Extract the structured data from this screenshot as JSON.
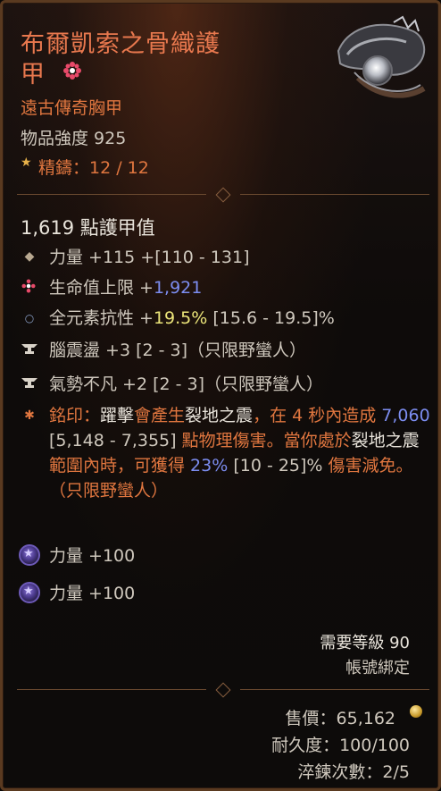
{
  "item": {
    "title_line1": "布爾凱索之骨織護",
    "title_line2": "甲",
    "icon": "armor-chest-icon",
    "type": "遠古傳奇胸甲",
    "item_power": "物品強度 925",
    "masterwork": "精鑄：12 / 12"
  },
  "stats": {
    "armor": "1,619 點護甲值",
    "affixes": [
      {
        "icon": "diamond-bullet-icon",
        "prefix": "力量 +115",
        "hl": "",
        "suffix": " +[110 - 131]"
      },
      {
        "icon": "flower-icon",
        "prefix": "生命值上限 +",
        "hl": "1,921",
        "suffix": ""
      },
      {
        "icon": "circle-bullet-icon",
        "prefix": "全元素抗性 +",
        "hl": "19.5%",
        "suffix": " [15.6 - 19.5]%"
      },
      {
        "icon": "anvil-icon",
        "prefix": "腦震盪 +3 [2 - 3]（只限野蠻人）",
        "hl": "",
        "suffix": ""
      },
      {
        "icon": "anvil-icon",
        "prefix": "氣勢不凡 +2 [2 - 3]（只限野蠻人）",
        "hl": "",
        "suffix": ""
      }
    ],
    "aspect": {
      "icon": "star-bullet-icon",
      "p1": "銘印：",
      "p2": "躍擊",
      "p3": "會產生",
      "p4": "裂地之震",
      "p5": "，在 4 秒內造成 ",
      "v1": "7,060",
      "p6": " [5,148 - 7,355] ",
      "p7": "點物理傷害。當你處於",
      "p8": "裂地之震",
      "p9": "範圍內時，可獲得 ",
      "v2": "23%",
      "p10": " [10 - 25]% ",
      "p11": "傷害減免。（只限野蠻人）"
    },
    "gems": [
      {
        "icon": "amethyst-gem-icon",
        "label": "力量 +100"
      },
      {
        "icon": "amethyst-gem-icon",
        "label": "力量 +100"
      }
    ]
  },
  "footer": {
    "level_req": "需要等級 90",
    "account_bound": "帳號綁定",
    "sell_value": "售價：65,162",
    "durability": "耐久度：100/100",
    "temper": "淬鍊次數：2/5"
  }
}
